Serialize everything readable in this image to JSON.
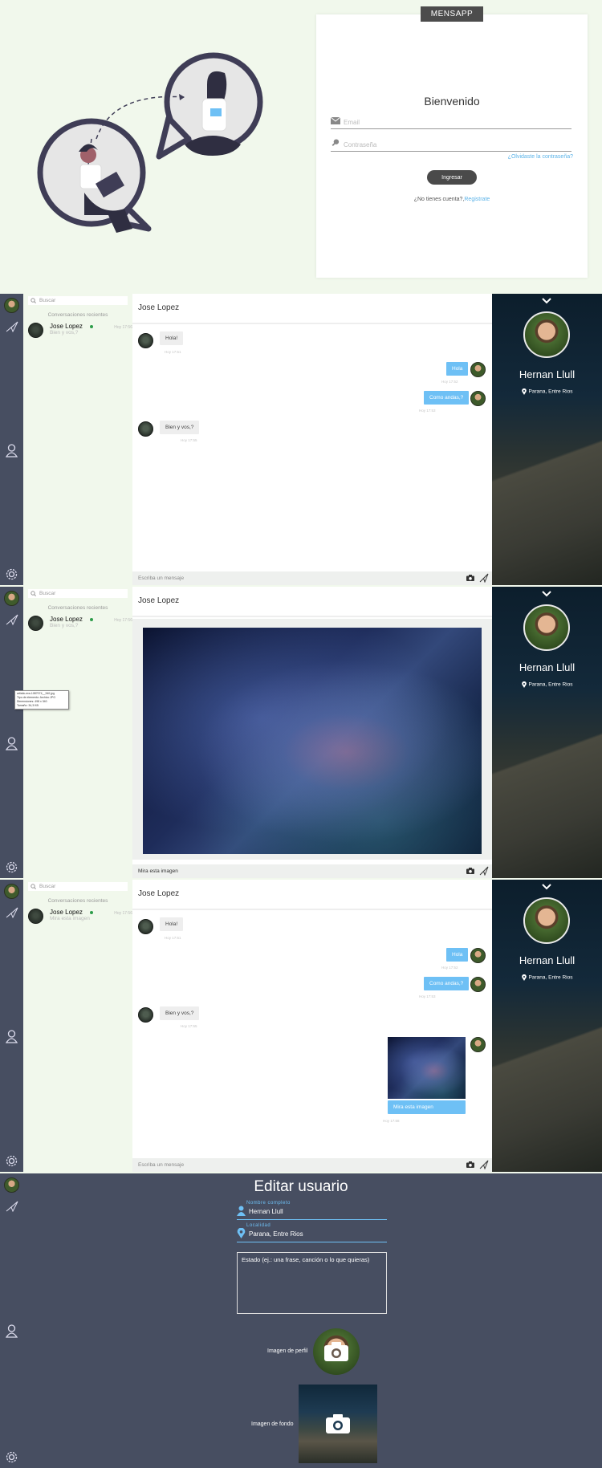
{
  "login": {
    "brand": "MENSAPP",
    "welcome": "Bienvenido",
    "email_placeholder": "Email",
    "password_placeholder": "Contraseña",
    "forgot": "¿Olvidaste la contraseña?",
    "submit": "Ingresar",
    "no_account": "¿No tienes cuenta?,",
    "register": "Registrate"
  },
  "sidebar": {
    "icons": [
      "avatar",
      "paper-plane-icon",
      "user-icon",
      "gear-icon"
    ]
  },
  "list": {
    "search_placeholder": "Buscar",
    "recent_title": "Conversaciones recientes",
    "contact_name": "Jose Lopez",
    "preview_1": "Bien y vos,?",
    "preview_3": "Mira esta imagen",
    "time": "Hoy 17:56"
  },
  "chat": {
    "header": "Jose Lopez",
    "composer_placeholder": "Escriba un mensaje",
    "composer_value_2": "Mira esta imagen",
    "messages": [
      {
        "text": "Hola!",
        "time": "Hoy 17:51"
      },
      {
        "text": "Hola",
        "time": "Hoy 17:52"
      },
      {
        "text": "Como andas,?",
        "time": "Hoy 17:53"
      },
      {
        "text": "Bien y vos,?",
        "time": "Hoy 17:55"
      },
      {
        "text": "Mira esta imagen",
        "time": "Hoy 17:58"
      }
    ]
  },
  "tooltip": {
    "line1": "artistic-mw-1087074__340.jpg",
    "line2": "Tipo de elemento: Archivo JPG",
    "line3": "Dimensiones: 498 x 340",
    "line4": "Tamaño: 34,3 KB"
  },
  "profile": {
    "name": "Hernan Llull",
    "location": "Parana, Entre Rios"
  },
  "edit": {
    "title": "Editar usuario",
    "name_label": "Nombre completo",
    "name_value": "Hernan Llull",
    "loc_label": "Localidad",
    "loc_value": "Parana, Entre Rios",
    "estado_placeholder": "Estado (ej.: una frase, canción o lo que quieras)",
    "profile_img_label": "Imagen de perfil",
    "bg_img_label": "Imagen de fondo"
  },
  "colors": {
    "accent": "#6ec0f5",
    "sidebar": "#474e61",
    "list_bg": "#f1f8ec",
    "online": "#2d9d4a"
  }
}
